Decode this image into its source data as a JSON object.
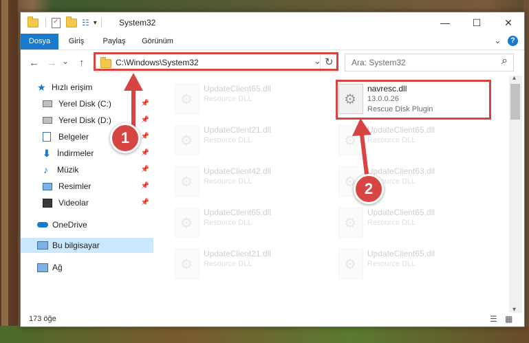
{
  "window": {
    "title": "System32",
    "min_glyph": "—",
    "max_glyph": "☐",
    "close_glyph": "✕",
    "qa_dropdown": "▾"
  },
  "ribbon": {
    "tabs": [
      {
        "label": "Dosya",
        "active": true
      },
      {
        "label": "Giriş",
        "active": false
      },
      {
        "label": "Paylaş",
        "active": false
      },
      {
        "label": "Görünüm",
        "active": false
      }
    ],
    "collapse_glyph": "⌄",
    "help_glyph": "?"
  },
  "nav": {
    "back_glyph": "←",
    "forward_glyph": "→",
    "recent_glyph": "⌄",
    "up_glyph": "↑",
    "address": "C:\\Windows\\System32",
    "address_dropdown": "⌄",
    "refresh_glyph": "↻",
    "search_placeholder": "Ara: System32",
    "search_glyph": "⌕"
  },
  "sidebar": {
    "items": [
      {
        "label": "Hızlı erişim",
        "icon": "star-icon",
        "pinned": false
      },
      {
        "label": "Yerel Disk (C:)",
        "icon": "drive-icon",
        "pinned": true
      },
      {
        "label": "Yerel Disk (D:)",
        "icon": "drive-icon",
        "pinned": true
      },
      {
        "label": "Belgeler",
        "icon": "documents-icon",
        "pinned": true
      },
      {
        "label": "İndirmeler",
        "icon": "downloads-icon",
        "pinned": true
      },
      {
        "label": "Müzik",
        "icon": "music-icon",
        "pinned": true
      },
      {
        "label": "Resimler",
        "icon": "pictures-icon",
        "pinned": true
      },
      {
        "label": "Videolar",
        "icon": "videos-icon",
        "pinned": true
      },
      {
        "label": "OneDrive",
        "icon": "cloud-icon",
        "pinned": false
      },
      {
        "label": "Bu bilgisayar",
        "icon": "computer-icon",
        "pinned": false
      },
      {
        "label": "Ağ",
        "icon": "network-icon",
        "pinned": false
      }
    ],
    "pin_glyph": "📌"
  },
  "files": {
    "highlighted": {
      "name": "navresc.dll",
      "version": "13.0.0.26",
      "description": "Rescue Disk Plugin"
    },
    "background": [
      {
        "name": "UpdateClient65.dll",
        "description": "Resource DLL"
      },
      {
        "name": "UpdateClient21.dll",
        "description": "Resource DLL"
      },
      {
        "name": "UpdateClient65.dll",
        "description": "Resource DLL"
      },
      {
        "name": "UpdateClient42.dll",
        "description": "Resource DLL"
      },
      {
        "name": "UpdateClient63.dll",
        "description": "Resource DLL"
      },
      {
        "name": "UpdateClient65.dll",
        "description": "Resource DLL"
      },
      {
        "name": "UpdateClient65.dll",
        "description": "Resource DLL"
      },
      {
        "name": "UpdateClient21.dll",
        "description": "Resource DLL"
      },
      {
        "name": "UpdateClient65.dll",
        "description": "Resource DLL"
      }
    ]
  },
  "status": {
    "count": "173 öğe",
    "details_view_glyph": "☰",
    "tiles_view_glyph": "▦"
  },
  "annotations": {
    "step1": "1",
    "step2": "2",
    "color": "#d64541"
  },
  "scrollbar": {
    "up_glyph": "▴",
    "down_glyph": "▾"
  }
}
